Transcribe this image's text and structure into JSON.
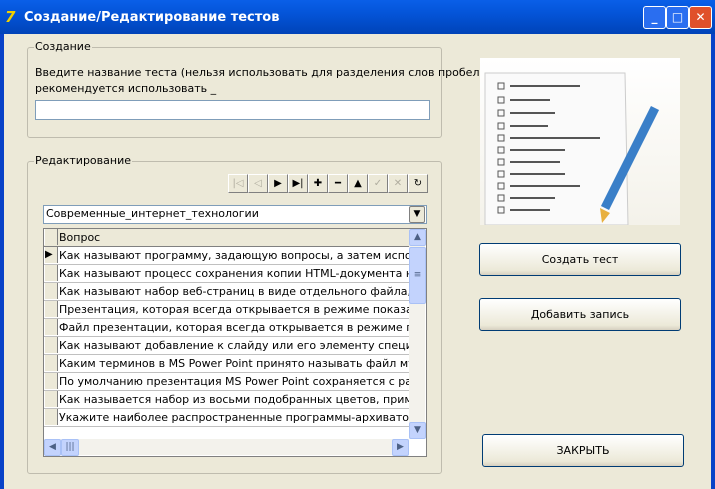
{
  "window": {
    "title": "Создание/Редактирование тестов",
    "minimize": "_",
    "maximize": "□",
    "close": "✕"
  },
  "create_group": {
    "legend": "Создание",
    "prompt_line1": "Введите название теста (нельзя использовать для разделения слов пробел",
    "prompt_line2": "рекомендуется использовать _",
    "name_value": ""
  },
  "edit_group": {
    "legend": "Редактирование",
    "navigator": [
      {
        "icon": "first-icon",
        "glyph": "|◁",
        "enabled": false
      },
      {
        "icon": "prior-icon",
        "glyph": "◁",
        "enabled": false
      },
      {
        "icon": "next-icon",
        "glyph": "▶",
        "enabled": true
      },
      {
        "icon": "last-icon",
        "glyph": "▶|",
        "enabled": true
      },
      {
        "icon": "insert-icon",
        "glyph": "✚",
        "enabled": true
      },
      {
        "icon": "delete-icon",
        "glyph": "━",
        "enabled": true
      },
      {
        "icon": "edit-icon",
        "glyph": "▲",
        "enabled": true
      },
      {
        "icon": "post-icon",
        "glyph": "✓",
        "enabled": false
      },
      {
        "icon": "cancel-icon",
        "glyph": "✕",
        "enabled": false
      },
      {
        "icon": "refresh-icon",
        "glyph": "↻",
        "enabled": true
      }
    ],
    "test_select": "Современные_интернет_технологии",
    "grid": {
      "header": "Вопрос",
      "rows": [
        "Как называют программу, задающую вопросы, а затем использующ",
        "Как называют процесс сохранения копии HTML-документа на веб-се",
        "Как называют набор веб-страниц в виде отдельного файла, включак",
        "Презентация, которая всегда открывается в режиме показа слайдс",
        "Файл презентации, которая всегда открывается в режиме показа с",
        "Как называют добавление к слайду или его элементу специального",
        "Каким терминов в MS Power Point принято называть файл мультиме",
        "По умолчанию презентация MS Power Point сохраняется с расширен",
        "Как называется набор из восьми подобранных цветов, применяемы",
        "Укажите наиболее распространенные программы-архиваторы"
      ]
    }
  },
  "buttons": {
    "create": "Создать тест",
    "add": "Добавить запись",
    "close": "ЗАКРЫТЬ"
  }
}
